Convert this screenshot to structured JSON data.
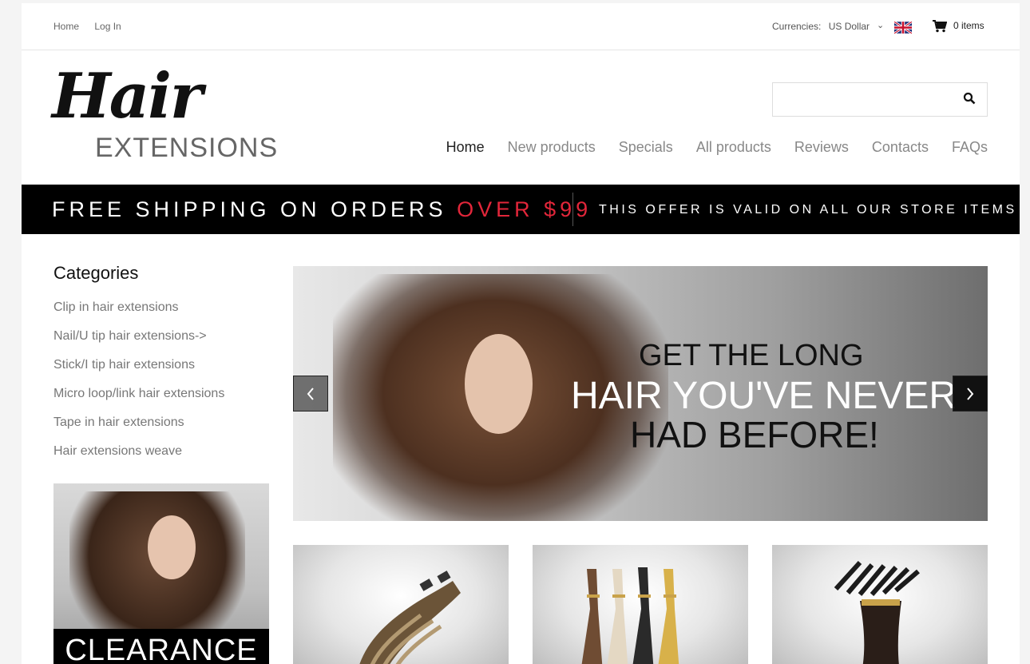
{
  "topbar": {
    "links": [
      "Home",
      "Log In"
    ],
    "currency_label": "Currencies:",
    "currency_value": "US Dollar",
    "cart_text": "0 items"
  },
  "logo": {
    "line1": "Hair",
    "line2": "EXTENSIONS"
  },
  "search": {
    "placeholder": ""
  },
  "nav": [
    "Home",
    "New products",
    "Specials",
    "All products",
    "Reviews",
    "Contacts",
    "FAQs"
  ],
  "banner": {
    "left_text": "FREE SHIPPING ON ORDERS ",
    "left_highlight": "OVER $99",
    "right_text": "THIS OFFER IS VALID ON ALL OUR STORE ITEMS",
    "highlight_color": "#e2263a"
  },
  "sidebar": {
    "title": "Categories",
    "categories": [
      "Clip in hair extensions",
      "Nail/U tip hair extensions->",
      "Stick/I tip hair extensions",
      "Micro loop/link hair extensions",
      "Tape in hair extensions",
      "Hair extensions weave"
    ],
    "promo_text": "CLEARANCE"
  },
  "slider": {
    "line1": "GET THE LONG",
    "line2": "HAIR YOU'VE NEVER",
    "line3": "HAD BEFORE!",
    "prev_icon": "chevron-left-icon",
    "next_icon": "chevron-right-icon"
  },
  "products": [
    "clip-in-wavy-hair-image",
    "u-tip-hair-bundles-image",
    "i-tip-hair-bundle-image"
  ]
}
